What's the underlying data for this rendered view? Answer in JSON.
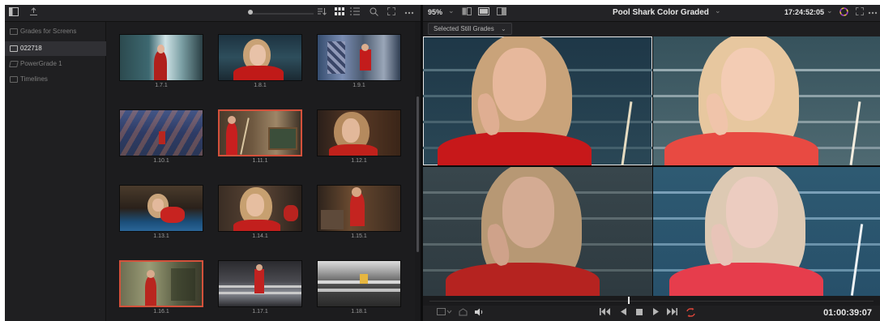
{
  "gallery_toolbar": {
    "icons": [
      "panel-toggle-icon",
      "upload-icon",
      "sort-icon",
      "grid-view-icon",
      "list-view-icon",
      "search-icon",
      "expand-icon",
      "more-icon"
    ]
  },
  "sidebar": {
    "items": [
      {
        "label": "Grades for Screens",
        "icon": "stills-album-icon"
      },
      {
        "label": "022718",
        "icon": "stills-album-icon",
        "active": true
      },
      {
        "label": "PowerGrade 1",
        "icon": "powergrade-album-icon"
      },
      {
        "label": "Timelines",
        "icon": "timeline-album-icon"
      }
    ]
  },
  "stills": [
    {
      "label": "1.7.1"
    },
    {
      "label": "1.8.1"
    },
    {
      "label": "1.9.1"
    },
    {
      "label": "1.10.1"
    },
    {
      "label": "1.11.1",
      "selected": true
    },
    {
      "label": "1.12.1"
    },
    {
      "label": "1.13.1"
    },
    {
      "label": "1.14.1"
    },
    {
      "label": "1.15.1"
    },
    {
      "label": "1.16.1",
      "selected": true
    },
    {
      "label": "1.17.1"
    },
    {
      "label": "1.18.1"
    }
  ],
  "viewer": {
    "zoom": "95%",
    "zoom_chevron": "⌄",
    "title": "Pool Shark Color Graded",
    "title_chevron": "⌄",
    "timecode_top": "17:24:52:05",
    "timecode_chevron": "⌄",
    "grade_dropdown": "Selected Still Grades",
    "dropdown_chevron": "⌄",
    "timecode_bottom": "01:00:39:07"
  },
  "transport": {
    "buttons": [
      "skip-to-start-icon",
      "play-reverse-icon",
      "stop-icon",
      "play-icon",
      "skip-to-end-icon",
      "loop-icon"
    ]
  },
  "colors": {
    "selection": "#d4513b",
    "loop_accent": "#e0463a",
    "background": "#1c1c1e"
  }
}
